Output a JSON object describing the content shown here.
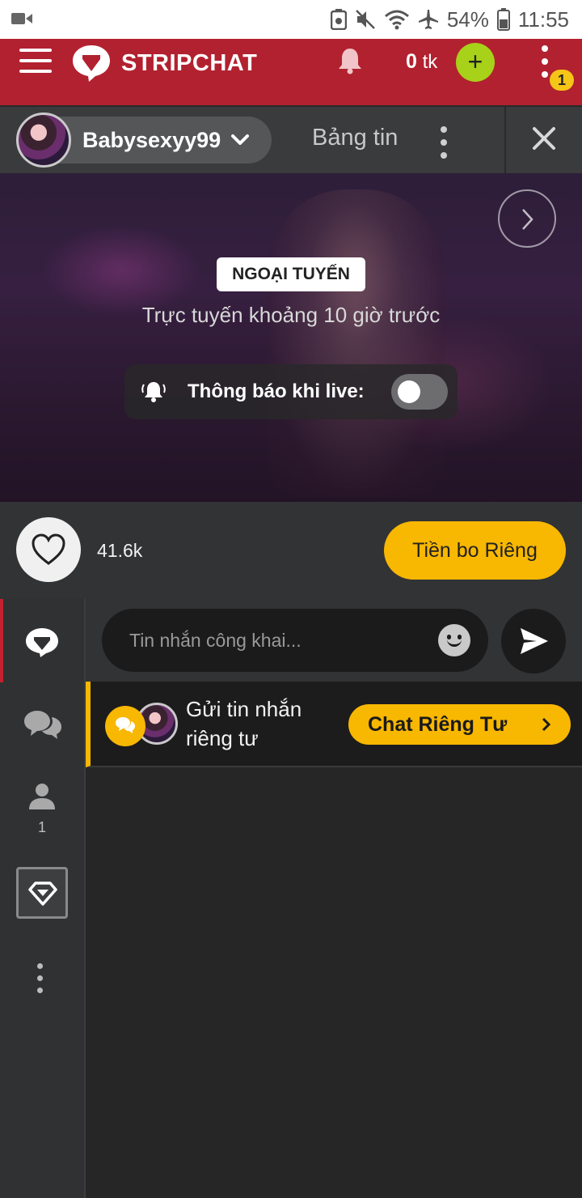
{
  "status_bar": {
    "battery": "54%",
    "time": "11:55",
    "icons": [
      "video-camera-icon",
      "recycle-icon",
      "mute-icon",
      "wifi-icon",
      "airplane-icon",
      "battery-icon"
    ]
  },
  "app_bar": {
    "brand": "STRIPCHAT",
    "tokens_value": "0",
    "tokens_unit": "tk",
    "add_label": "+",
    "notification_badge": "1",
    "colors": {
      "bar": "#b2212f",
      "add_button": "#a8d11a",
      "badge": "#f5c518"
    }
  },
  "model_bar": {
    "model_name": "Babysexyy99",
    "feed_tab": "Bảng tin"
  },
  "video": {
    "status_badge": "NGOẠI TUYẾN",
    "last_online": "Trực tuyến khoảng 10 giờ trước",
    "notify_label": "Thông báo khi live:",
    "notify_enabled": false
  },
  "actions": {
    "like_count": "41.6k",
    "tip_label": "Tiền bo Riêng",
    "accent": "#f8b700"
  },
  "rail": {
    "users_count": "1",
    "active_color": "#c4202f"
  },
  "chat": {
    "input_placeholder": "Tin nhắn công khai...",
    "pm_text": "Gửi tin nhắn riêng tư",
    "pm_button": "Chat Riêng Tư"
  }
}
